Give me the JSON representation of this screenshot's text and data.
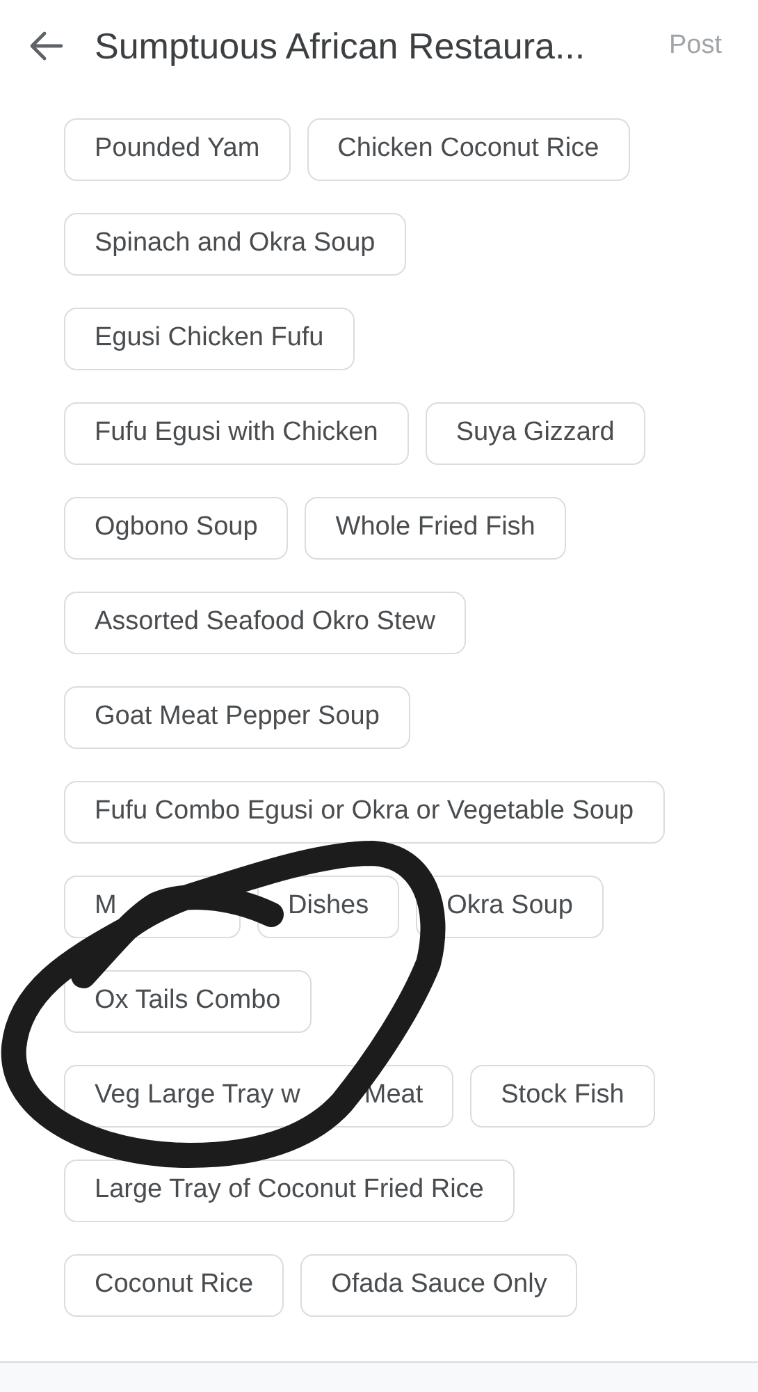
{
  "header": {
    "title": "Sumptuous African Restaura...",
    "action": "Post"
  },
  "chip_rows": [
    [
      {
        "parts": [
          "Pounded Yam"
        ]
      },
      {
        "parts": [
          "Chicken Coconut Rice"
        ]
      }
    ],
    [
      {
        "parts": [
          "Spinach and Okra Soup"
        ]
      }
    ],
    [
      {
        "parts": [
          "Egusi Chicken Fufu"
        ]
      }
    ],
    [
      {
        "parts": [
          "Fufu Egusi with Chicken"
        ]
      },
      {
        "parts": [
          "Suya Gizzard"
        ]
      }
    ],
    [
      {
        "parts": [
          "Ogbono Soup"
        ]
      },
      {
        "parts": [
          "Whole Fried Fish"
        ]
      }
    ],
    [
      {
        "parts": [
          "Assorted Seafood Okro Stew"
        ]
      }
    ],
    [
      {
        "parts": [
          "Goat Meat Pepper Soup"
        ]
      }
    ],
    [
      {
        "parts": [
          "Fufu Combo Egusi or Okra or Vegetable Soup"
        ]
      }
    ],
    [
      {
        "parts": [
          "M"
        ]
      },
      {
        "parts": [
          "Dishes"
        ]
      },
      {
        "parts": [
          "Okra Soup"
        ]
      }
    ],
    [
      {
        "parts": [
          "Ox Tails Combo"
        ]
      }
    ],
    [
      {
        "parts": [
          "Veg Large Tray w",
          "Meat"
        ]
      },
      {
        "parts": [
          "Stock Fish"
        ]
      }
    ],
    [
      {
        "parts": [
          "Large Tray of Coconut Fried Rice"
        ]
      }
    ],
    [
      {
        "parts": [
          "Coconut Rice"
        ]
      },
      {
        "parts": [
          "Ofada Sauce Only"
        ]
      }
    ]
  ]
}
